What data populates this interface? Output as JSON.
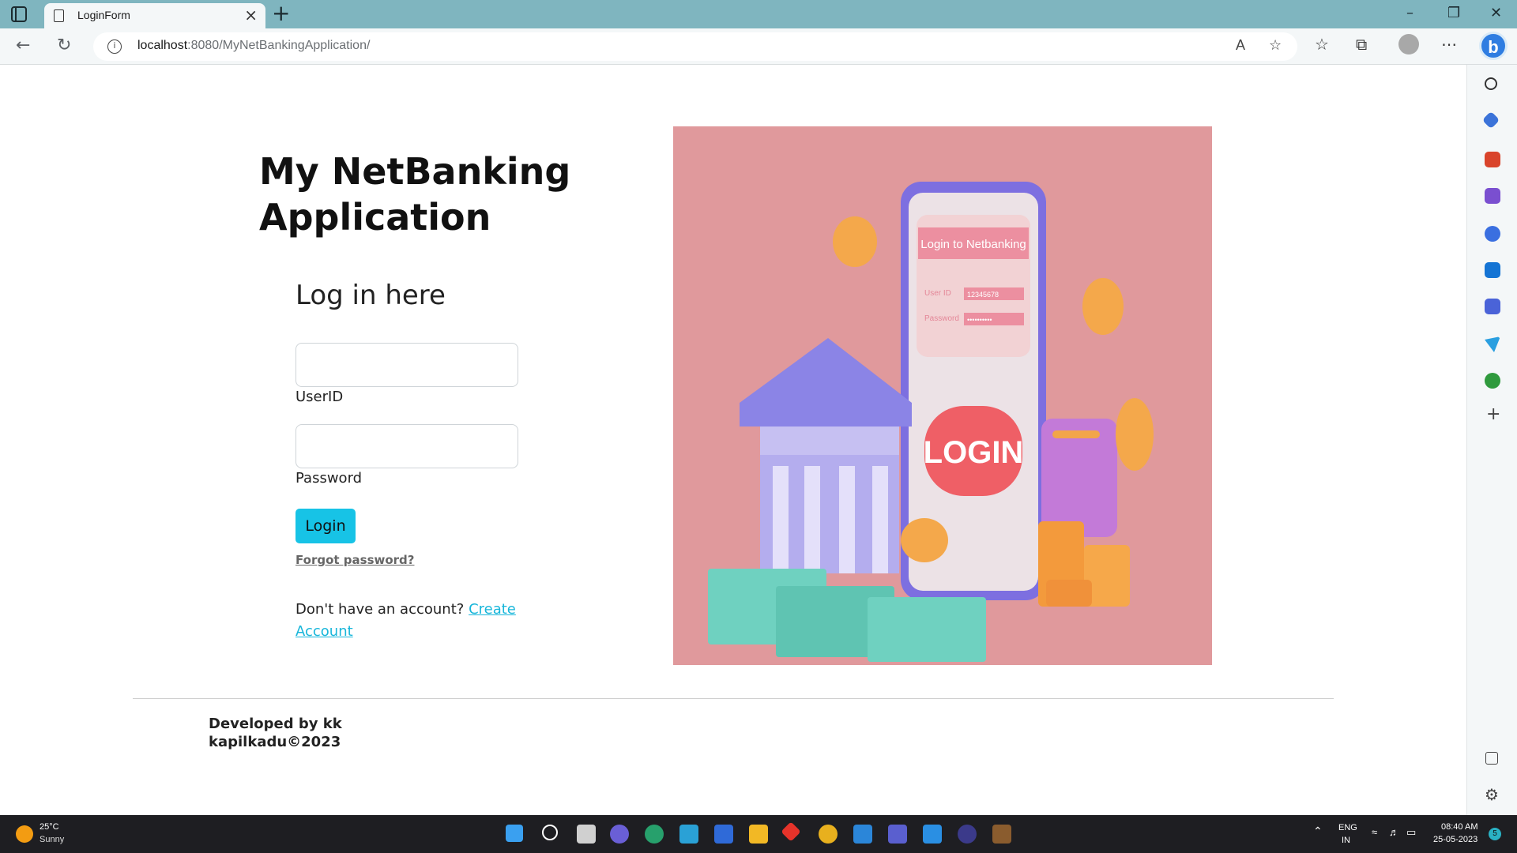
{
  "browser": {
    "tab_title": "LoginForm",
    "tab_close": "×",
    "new_tab": "+",
    "url_host": "localhost",
    "url_rest": ":8080/MyNetBankingApplication/",
    "read_aloud": "A",
    "bing": "b"
  },
  "page": {
    "app_title": "My NetBanking Application",
    "login_heading": "Log in here",
    "userid_label": "UserID",
    "password_label": "Password",
    "login_button": "Login",
    "forgot_password": "Forgot password?",
    "no_account_text": "Don't have an account?",
    "create_account_link": "Create Account",
    "footer_developer": "Developed by kk",
    "footer_copyright": "kapilkadu©2023"
  },
  "hero": {
    "screen_header": "Login to Netbanking",
    "userid_caption": "User ID",
    "userid_value": "12345678",
    "password_caption": "Password",
    "password_value": "••••••••••",
    "login_text": "LOGIN"
  },
  "taskbar": {
    "weather_temp": "25°C",
    "weather_condition": "Sunny",
    "language_1": "ENG",
    "language_2": "IN",
    "time": "08:40 AM",
    "date": "25-05-2023",
    "notification_count": "5"
  },
  "colors": {
    "accent_cyan": "#17c3e6",
    "link_cyan": "#17b6da",
    "hero_bg": "#e0999c",
    "titlebar": "#7fb5bf"
  }
}
